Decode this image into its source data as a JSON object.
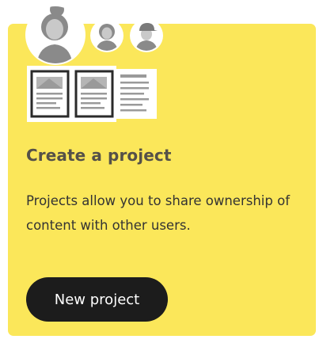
{
  "card": {
    "title": "Create a project",
    "description": "Projects allow you to share ownership of content with other users.",
    "button_label": "New project"
  },
  "colors": {
    "card_background": "#fbe75a",
    "button_background": "#1c1c1c",
    "button_text": "#ffffff",
    "title_text": "#555148"
  },
  "icons": [
    "user-avatar-large-icon",
    "user-avatar-small-icon",
    "user-avatar-cap-icon",
    "document-icon"
  ]
}
